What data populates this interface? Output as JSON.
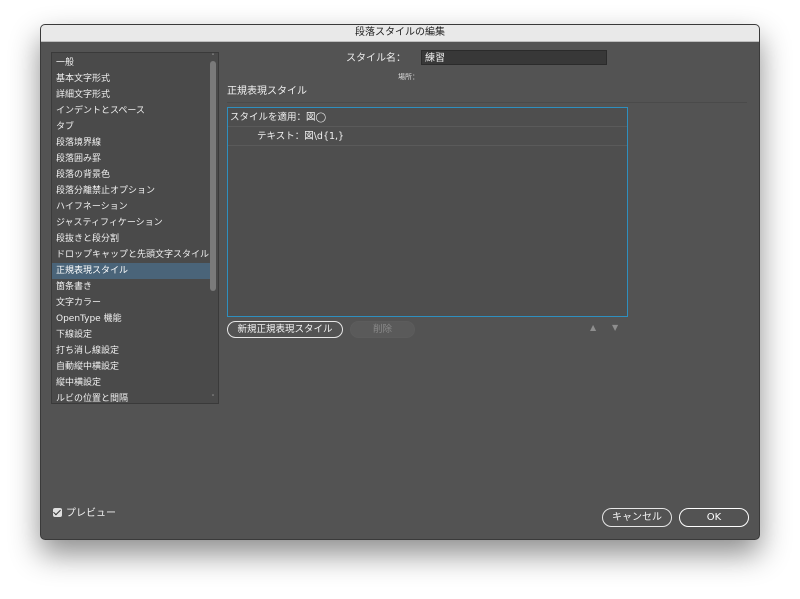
{
  "window": {
    "title": "段落スタイルの編集"
  },
  "sidebar": {
    "items": [
      {
        "label": "一般"
      },
      {
        "label": "基本文字形式"
      },
      {
        "label": "詳細文字形式"
      },
      {
        "label": "インデントとスペース"
      },
      {
        "label": "タブ"
      },
      {
        "label": "段落境界線"
      },
      {
        "label": "段落囲み罫"
      },
      {
        "label": "段落の背景色"
      },
      {
        "label": "段落分離禁止オプション"
      },
      {
        "label": "ハイフネーション"
      },
      {
        "label": "ジャスティフィケーション"
      },
      {
        "label": "段抜きと段分割"
      },
      {
        "label": "ドロップキャップと先頭文字スタイル"
      },
      {
        "label": "正規表現スタイル",
        "selected": true
      },
      {
        "label": "箇条書き"
      },
      {
        "label": "文字カラー"
      },
      {
        "label": "OpenType 機能"
      },
      {
        "label": "下線設定"
      },
      {
        "label": "打ち消し線設定"
      },
      {
        "label": "自動縦中横設定"
      },
      {
        "label": "縦中横設定"
      },
      {
        "label": "ルビの位置と間隔"
      }
    ]
  },
  "style_name": {
    "label": "スタイル名：",
    "value": "練習"
  },
  "location": {
    "label": "場所："
  },
  "section": {
    "title": "正規表現スタイル"
  },
  "rules": {
    "apply_style": "スタイルを適用：図◯",
    "text": "テキスト：図\\d{1,}"
  },
  "buttons": {
    "new_grep": "新規正規表現スタイル",
    "delete": "削除",
    "move_up": "▲",
    "move_down": "▼",
    "cancel": "キャンセル",
    "ok": "OK"
  },
  "preview": {
    "label": "プレビュー",
    "checked": true
  },
  "colors": {
    "dialog_bg": "#535353",
    "selection": "#4a6479",
    "focus_border": "#2e8fbf"
  }
}
